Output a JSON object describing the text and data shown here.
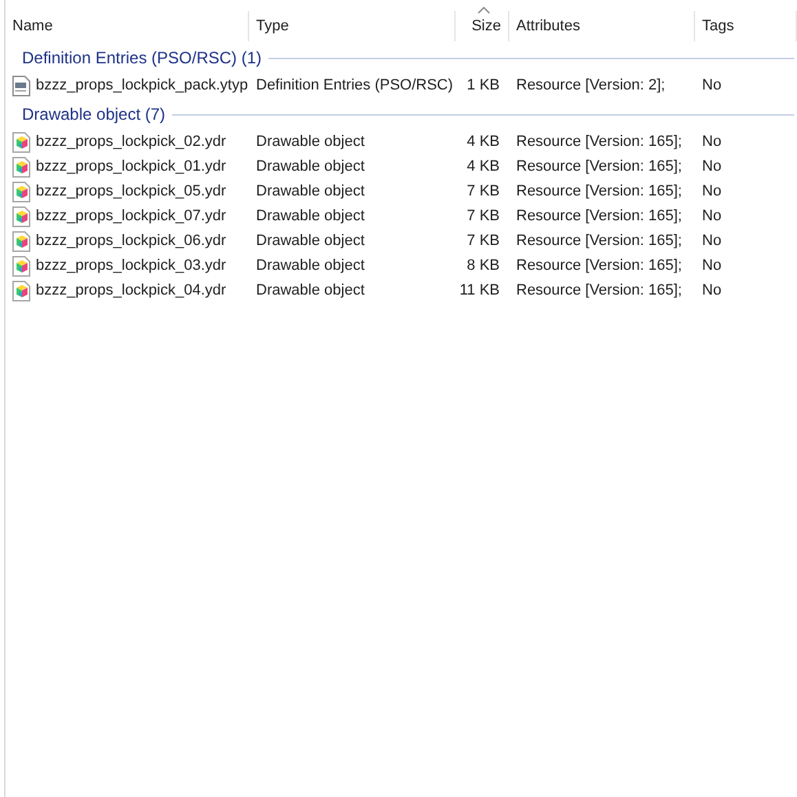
{
  "columns": [
    {
      "label": "Name",
      "sorted": false
    },
    {
      "label": "Type",
      "sorted": false
    },
    {
      "label": "Size",
      "sorted": true
    },
    {
      "label": "Attributes",
      "sorted": false
    },
    {
      "label": "Tags",
      "sorted": false
    }
  ],
  "groups": [
    {
      "title": "Definition Entries (PSO/RSC) (1)",
      "rows": [
        {
          "kind": "definition",
          "name": "bzzz_props_lockpick_pack.ytyp",
          "type": "Definition Entries (PSO/RSC)",
          "size": "1 KB",
          "attributes": "Resource [Version: 2];",
          "tags": "No"
        }
      ]
    },
    {
      "title": "Drawable object (7)",
      "rows": [
        {
          "kind": "drawable",
          "name": "bzzz_props_lockpick_02.ydr",
          "type": "Drawable object",
          "size": "4 KB",
          "attributes": "Resource [Version: 165];",
          "tags": "No"
        },
        {
          "kind": "drawable",
          "name": "bzzz_props_lockpick_01.ydr",
          "type": "Drawable object",
          "size": "4 KB",
          "attributes": "Resource [Version: 165];",
          "tags": "No"
        },
        {
          "kind": "drawable",
          "name": "bzzz_props_lockpick_05.ydr",
          "type": "Drawable object",
          "size": "7 KB",
          "attributes": "Resource [Version: 165];",
          "tags": "No"
        },
        {
          "kind": "drawable",
          "name": "bzzz_props_lockpick_07.ydr",
          "type": "Drawable object",
          "size": "7 KB",
          "attributes": "Resource [Version: 165];",
          "tags": "No"
        },
        {
          "kind": "drawable",
          "name": "bzzz_props_lockpick_06.ydr",
          "type": "Drawable object",
          "size": "7 KB",
          "attributes": "Resource [Version: 165];",
          "tags": "No"
        },
        {
          "kind": "drawable",
          "name": "bzzz_props_lockpick_03.ydr",
          "type": "Drawable object",
          "size": "8 KB",
          "attributes": "Resource [Version: 165];",
          "tags": "No"
        },
        {
          "kind": "drawable",
          "name": "bzzz_props_lockpick_04.ydr",
          "type": "Drawable object",
          "size": "11 KB",
          "attributes": "Resource [Version: 165];",
          "tags": "No"
        }
      ]
    }
  ]
}
